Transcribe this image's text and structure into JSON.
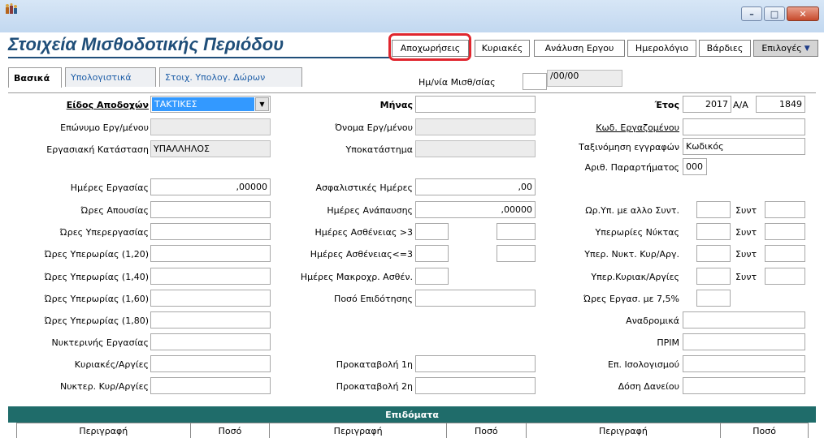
{
  "window": {
    "app_icon": "app-icon",
    "buttons": [
      {
        "name": "minimize-button",
        "glyph": "–"
      },
      {
        "name": "maximize-button",
        "glyph": "□"
      },
      {
        "name": "close-button",
        "glyph": "✕"
      }
    ]
  },
  "header": {
    "title": "Στοιχεία Μισθοδοτικής Περιόδου",
    "buttons": [
      {
        "label": "Αποχωρήσεις",
        "highlighted": true
      },
      {
        "label": "Κυριακές"
      },
      {
        "label": "Ανάλυση Εργου"
      },
      {
        "label": "Ημερολόγιο"
      },
      {
        "label": "Βάρδιες"
      },
      {
        "label": "Επιλογές",
        "has_dropdown": true
      }
    ],
    "highlight_color": "#e0262e"
  },
  "tabs": {
    "items": [
      {
        "label": "Βασικά",
        "active": true
      },
      {
        "label": "Υπολογιστικά"
      },
      {
        "label": "Στοιχ. Υπολογ. Δώρων"
      }
    ],
    "payroll_date_label": "Ημ/νία Μισθ/σίας",
    "payroll_date_value": "/00/00"
  },
  "form": {
    "col1": {
      "earnings_type_label": "Είδος Αποδοχών",
      "earnings_type_value": "ΤΑΚΤΙΚΕΣ",
      "employer_surname_label": "Επώνυμο Εργ/μένου",
      "employment_status_label": "Εργασιακή Κατάσταση",
      "employment_status_value": "ΥΠΑΛΛΗΛΟΣ",
      "work_days_label": "Ημέρες Εργασίας",
      "work_days_value": ",00000",
      "absence_hours_label": "Ώρες Απουσίας",
      "overwork_hours_label": "Ώρες Υπερεργασίας",
      "overtime_120_label": "Ώρες Υπερωρίας (1,20)",
      "overtime_140_label": "Ώρες Υπερωρίας (1,40)",
      "overtime_160_label": "Ώρες Υπερωρίας (1,60)",
      "overtime_180_label": "Ώρες Υπερωρίας (1,80)",
      "night_work_label": "Νυκτερινής Εργασίας",
      "sundays_holidays_label": "Κυριακές/Αργίες",
      "night_sundays_label": "Νυκτερ. Κυρ/Αργίες"
    },
    "col2": {
      "month_label": "Μήνας",
      "employee_name_label": "Όνομα Εργ/μένου",
      "branch_label": "Υποκατάστημα",
      "insurance_days_label": "Ασφαλιστικές Ημέρες",
      "insurance_days_value": ",00",
      "rest_days_label": "Ημέρες Ανάπαυσης",
      "rest_days_value": ",00000",
      "sick_gt3_label": "Ημέρες Ασθένειας >3",
      "sick_le3_label": "Ημέρες Ασθένειας<=3",
      "long_sick_label": "Ημέρες Μακροχρ. Ασθέν.",
      "subsidy_label": "Ποσό Επιδότησης",
      "advance1_label": "Προκαταβολή 1η",
      "advance2_label": "Προκαταβολή 2η"
    },
    "col3": {
      "year_label": "Έτος",
      "year_value": "2017",
      "aa_label": "Α/Α",
      "aa_value": "1849",
      "employee_code_label": "Κωδ. Εργαζομένου",
      "sort_label": "Ταξινόμηση εγγραφών",
      "sort_value": "Κωδικός",
      "branch_no_label": "Αριθ. Παραρτήματος",
      "branch_no_value": "000",
      "overtime_other_label": "Ωρ.Υπ. με αλλο Συντ.",
      "night_overtime_label": "Υπερωρίες Νύκτας",
      "night_holiday_ot_label": "Υπερ. Νυκτ. Κυρ/Αργ.",
      "sunday_holiday_ot_label": "Υπερ.Κυριακ/Αργίες",
      "coef_label": "Συντ",
      "hours_75_label": "Ώρες Εργασ. με 7,5%",
      "retroactive_label": "Αναδρομικά",
      "prim_label": "ΠΡΙΜ",
      "balance_label": "Επ. Ισολογισμού",
      "loan_label": "Δόση Δανείου"
    }
  },
  "allowances": {
    "title": "Επιδόματα",
    "columns": [
      "Περιγραφή",
      "Ποσό",
      "Περιγραφή",
      "Ποσό",
      "Περιγραφή",
      "Ποσό"
    ]
  },
  "colors": {
    "title": "#1f4e79",
    "band": "#1f6c6a",
    "selection": "#3399ff"
  }
}
